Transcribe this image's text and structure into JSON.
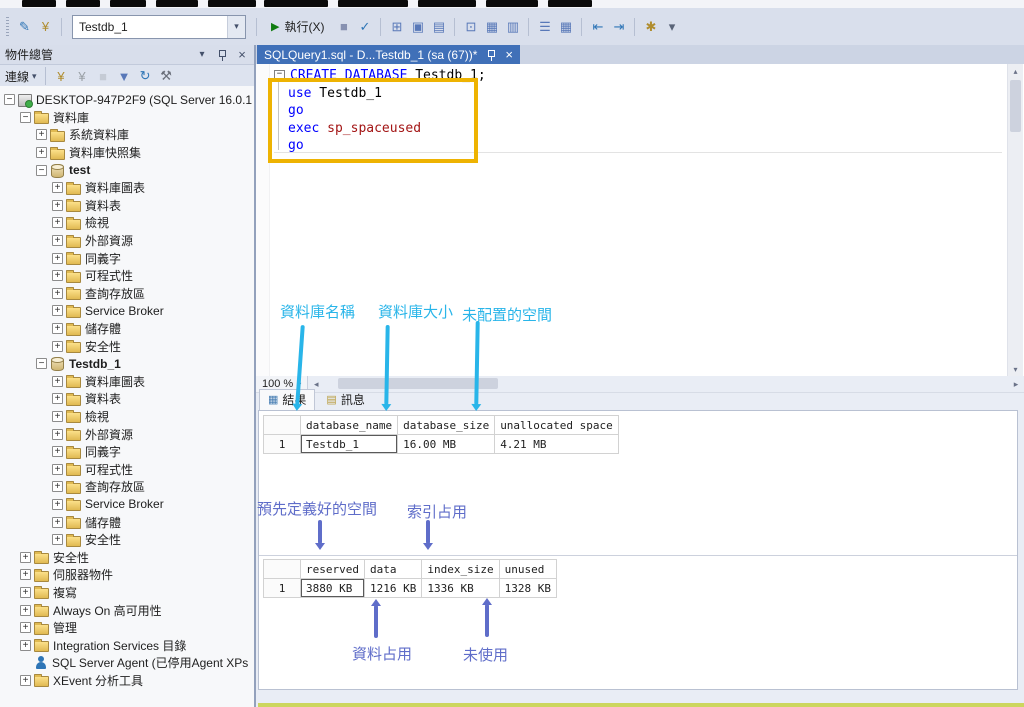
{
  "colors": {
    "annotation_cyan": "#29b5e9",
    "annotation_purple": "#5f6dc9",
    "highlight_box": "#eeb302",
    "active_tab": "#4070b8",
    "keyword_blue": "#0000ff",
    "system_proc_red": "#a31515"
  },
  "toolbar": {
    "left_icons": [
      {
        "name": "new-query-icon",
        "glyph": "✎",
        "color": "#2e75b6"
      },
      {
        "name": "change-connection-icon",
        "glyph": "¥",
        "color": "#b08d2f"
      }
    ],
    "database_combo": {
      "value": "Testdb_1"
    },
    "execute": {
      "label": "執行(X)"
    },
    "icons": [
      {
        "name": "cancel-query-icon",
        "glyph": "■",
        "color": "#26336b",
        "disabled": true
      },
      {
        "name": "parse-query-icon",
        "glyph": "✓",
        "color": "#2e75b6"
      },
      {
        "sep": true
      },
      {
        "name": "estimated-plan-icon",
        "glyph": "⊞",
        "color": "#5878b8"
      },
      {
        "name": "query-options-icon",
        "glyph": "▣",
        "color": "#5878b8"
      },
      {
        "name": "intellisense-icon",
        "glyph": "▤",
        "color": "#5878b8"
      },
      {
        "sep": true
      },
      {
        "name": "actual-plan-icon",
        "glyph": "⊡",
        "color": "#5878b8"
      },
      {
        "name": "live-query-stats-icon",
        "glyph": "▦",
        "color": "#5878b8"
      },
      {
        "name": "client-stats-icon",
        "glyph": "▥",
        "color": "#5878b8"
      },
      {
        "sep": true
      },
      {
        "name": "results-to-text-icon",
        "glyph": "☰",
        "color": "#5878b8"
      },
      {
        "name": "results-to-grid-icon",
        "glyph": "▦",
        "color": "#5878b8"
      },
      {
        "sep": true
      },
      {
        "name": "outdent-icon",
        "glyph": "⇤",
        "color": "#2e75b6"
      },
      {
        "name": "indent-icon",
        "glyph": "⇥",
        "color": "#2e75b6"
      },
      {
        "sep": true
      },
      {
        "name": "template-parameters-icon",
        "glyph": "✱",
        "color": "#b08d2f"
      },
      {
        "name": "toolbar-overflow-icon",
        "glyph": "▾",
        "color": "#5a6478"
      }
    ]
  },
  "object_explorer": {
    "title": "物件總管",
    "toolbar": {
      "connect_label": "連線",
      "icons": [
        {
          "name": "connect-icon",
          "glyph": "¥",
          "color": "#b08d2f"
        },
        {
          "name": "disconnect-icon",
          "glyph": "¥",
          "color": "#9aa0a6"
        },
        {
          "name": "stop-icon",
          "glyph": "■",
          "color": "#aab0b6",
          "disabled": true
        },
        {
          "name": "filter-icon",
          "glyph": "▼",
          "color": "#5878b8"
        },
        {
          "name": "refresh-icon",
          "glyph": "↻",
          "color": "#2e75b6"
        },
        {
          "name": "activity-monitor-icon",
          "glyph": "⚒",
          "color": "#6a6f7a"
        }
      ]
    },
    "tree": [
      {
        "label": "DESKTOP-947P2F9 (SQL Server 16.0.1",
        "lv": 0,
        "exp": "minus",
        "icon": "server"
      },
      {
        "label": "資料庫",
        "lv": 1,
        "exp": "minus",
        "icon": "folder"
      },
      {
        "label": "系統資料庫",
        "lv": 2,
        "exp": "plus",
        "icon": "folder"
      },
      {
        "label": "資料庫快照集",
        "lv": 2,
        "exp": "plus",
        "icon": "folder"
      },
      {
        "label": "test",
        "lv": 2,
        "exp": "minus",
        "icon": "db",
        "bold": true
      },
      {
        "label": "資料庫圖表",
        "lv": 3,
        "exp": "plus",
        "icon": "folder"
      },
      {
        "label": "資料表",
        "lv": 3,
        "exp": "plus",
        "icon": "folder"
      },
      {
        "label": "檢視",
        "lv": 3,
        "exp": "plus",
        "icon": "folder"
      },
      {
        "label": "外部資源",
        "lv": 3,
        "exp": "plus",
        "icon": "folder"
      },
      {
        "label": "同義字",
        "lv": 3,
        "exp": "plus",
        "icon": "folder"
      },
      {
        "label": "可程式性",
        "lv": 3,
        "exp": "plus",
        "icon": "folder"
      },
      {
        "label": "查詢存放區",
        "lv": 3,
        "exp": "plus",
        "icon": "folder"
      },
      {
        "label": "Service Broker",
        "lv": 3,
        "exp": "plus",
        "icon": "folder"
      },
      {
        "label": "儲存體",
        "lv": 3,
        "exp": "plus",
        "icon": "folder"
      },
      {
        "label": "安全性",
        "lv": 3,
        "exp": "plus",
        "icon": "folder"
      },
      {
        "label": "Testdb_1",
        "lv": 2,
        "exp": "minus",
        "icon": "db",
        "bold": true
      },
      {
        "label": "資料庫圖表",
        "lv": 3,
        "exp": "plus",
        "icon": "folder"
      },
      {
        "label": "資料表",
        "lv": 3,
        "exp": "plus",
        "icon": "folder"
      },
      {
        "label": "檢視",
        "lv": 3,
        "exp": "plus",
        "icon": "folder"
      },
      {
        "label": "外部資源",
        "lv": 3,
        "exp": "plus",
        "icon": "folder"
      },
      {
        "label": "同義字",
        "lv": 3,
        "exp": "plus",
        "icon": "folder"
      },
      {
        "label": "可程式性",
        "lv": 3,
        "exp": "plus",
        "icon": "folder"
      },
      {
        "label": "查詢存放區",
        "lv": 3,
        "exp": "plus",
        "icon": "folder"
      },
      {
        "label": "Service Broker",
        "lv": 3,
        "exp": "plus",
        "icon": "folder"
      },
      {
        "label": "儲存體",
        "lv": 3,
        "exp": "plus",
        "icon": "folder"
      },
      {
        "label": "安全性",
        "lv": 3,
        "exp": "plus",
        "icon": "folder"
      },
      {
        "label": "安全性",
        "lv": 1,
        "exp": "plus",
        "icon": "folder"
      },
      {
        "label": "伺服器物件",
        "lv": 1,
        "exp": "plus",
        "icon": "folder"
      },
      {
        "label": "複寫",
        "lv": 1,
        "exp": "plus",
        "icon": "folder"
      },
      {
        "label": "Always On 高可用性",
        "lv": 1,
        "exp": "plus",
        "icon": "folder"
      },
      {
        "label": "管理",
        "lv": 1,
        "exp": "plus",
        "icon": "folder"
      },
      {
        "label": "Integration Services 目錄",
        "lv": 1,
        "exp": "plus",
        "icon": "folder"
      },
      {
        "label": "SQL Server Agent (已停用Agent XPs",
        "lv": 1,
        "exp": "none",
        "icon": "agent"
      },
      {
        "label": "XEvent 分析工具",
        "lv": 1,
        "exp": "plus",
        "icon": "folder"
      }
    ]
  },
  "document": {
    "tab": {
      "title": "SQLQuery1.sql - D...Testdb_1 (sa (67))*"
    },
    "code": [
      {
        "fold": "minus",
        "tokens": [
          {
            "text": "CREATE DATABASE",
            "cls": "kw"
          },
          {
            "text": " Testdb_1;",
            "cls": "id"
          }
        ]
      },
      {
        "tokens": [
          {
            "text": "use",
            "cls": "kw"
          },
          {
            "text": " Testdb_1",
            "cls": "id"
          }
        ]
      },
      {
        "tokens": [
          {
            "text": "go",
            "cls": "kw"
          }
        ]
      },
      {
        "tokens": [
          {
            "text": "exec",
            "cls": "kw"
          },
          {
            "text": " sp_spaceused",
            "cls": "proc"
          }
        ]
      },
      {
        "tokens": [
          {
            "text": "go",
            "cls": "kw"
          }
        ]
      }
    ]
  },
  "results_pane": {
    "zoom": "100 %",
    "tabs": [
      {
        "label": "結果"
      },
      {
        "label": "訊息"
      }
    ],
    "grids": [
      {
        "columns": [
          "database_name",
          "database_size",
          "unallocated space"
        ],
        "rows": [
          {
            "num": "1",
            "cells": [
              "Testdb_1",
              "16.00 MB",
              "4.21 MB"
            ]
          }
        ],
        "selected": {
          "row": 0,
          "col": 0
        }
      },
      {
        "columns": [
          "reserved",
          "data",
          "index_size",
          "unused"
        ],
        "rows": [
          {
            "num": "1",
            "cells": [
              "3880 KB",
              "1216 KB",
              "1336 KB",
              "1328 KB"
            ]
          }
        ],
        "selected": {
          "row": 0,
          "col": 0
        }
      }
    ]
  },
  "annotations": {
    "database_name": "資料庫名稱",
    "database_size": "資料庫大小",
    "unallocated_space": "未配置的空間",
    "reserved_space": "預先定義好的空間",
    "index_used": "索引占用",
    "data_used": "資料占用",
    "unused": "未使用"
  }
}
